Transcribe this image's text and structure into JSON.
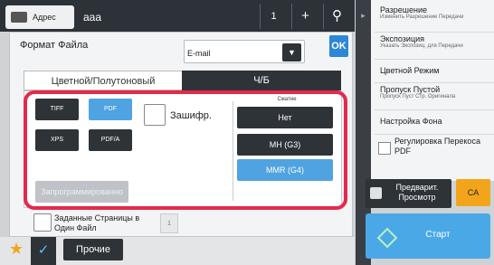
{
  "header": {
    "address_label": "Адрес",
    "address_value": "aaa",
    "counter": "1",
    "plus_icon": "plus-icon",
    "search_icon": "search-icon"
  },
  "dialog": {
    "format_label": "Формат Файла",
    "destination": "E-mail",
    "ok_label": "OK",
    "tabs": [
      "Цветной/Полутоновый",
      "Ч/Б"
    ],
    "active_tab": "Ч/Б",
    "formats": [
      {
        "label": "TIFF",
        "selected": false
      },
      {
        "label": "PDF",
        "selected": true
      },
      {
        "label": "XPS",
        "selected": false
      },
      {
        "label": "PDF/A",
        "selected": false
      }
    ],
    "encrypt_label": "Зашифр.",
    "program_label": "Запрограммированно",
    "compression_label": "Сжатие",
    "compression_options": [
      {
        "label": "Нет",
        "selected": false
      },
      {
        "label": "MH (G3)",
        "selected": false
      },
      {
        "label": "MMR (G4)",
        "selected": true
      }
    ],
    "pages_label": "Заданные Страницы в Один Файл",
    "pages_value": "1"
  },
  "bottom": {
    "other_label": "Прочие"
  },
  "right_menu": {
    "items": [
      {
        "title": "Разрешение",
        "subtitle": "Изменить Разрешение Передачи"
      },
      {
        "title": "Экспозиция",
        "subtitle": "Указать Экспозиц. для Передачи"
      },
      {
        "title": "Цветной Режим",
        "subtitle": ""
      },
      {
        "title": "Пропуск Пустой",
        "subtitle": "Пропуск Пуст Стр. Оригинала"
      },
      {
        "title": "Настройка Фона",
        "subtitle": ""
      },
      {
        "title": "Регулировка Перекоса PDF",
        "subtitle": ""
      }
    ],
    "preview_label": "Предварит. Просмотр",
    "ca_label": "CA",
    "start_label": "Старт"
  },
  "colors": {
    "highlight": "#e4294c",
    "accent_blue": "#4fa3e0",
    "dark_button": "#2e3338",
    "ca_orange": "#f2a51b"
  }
}
